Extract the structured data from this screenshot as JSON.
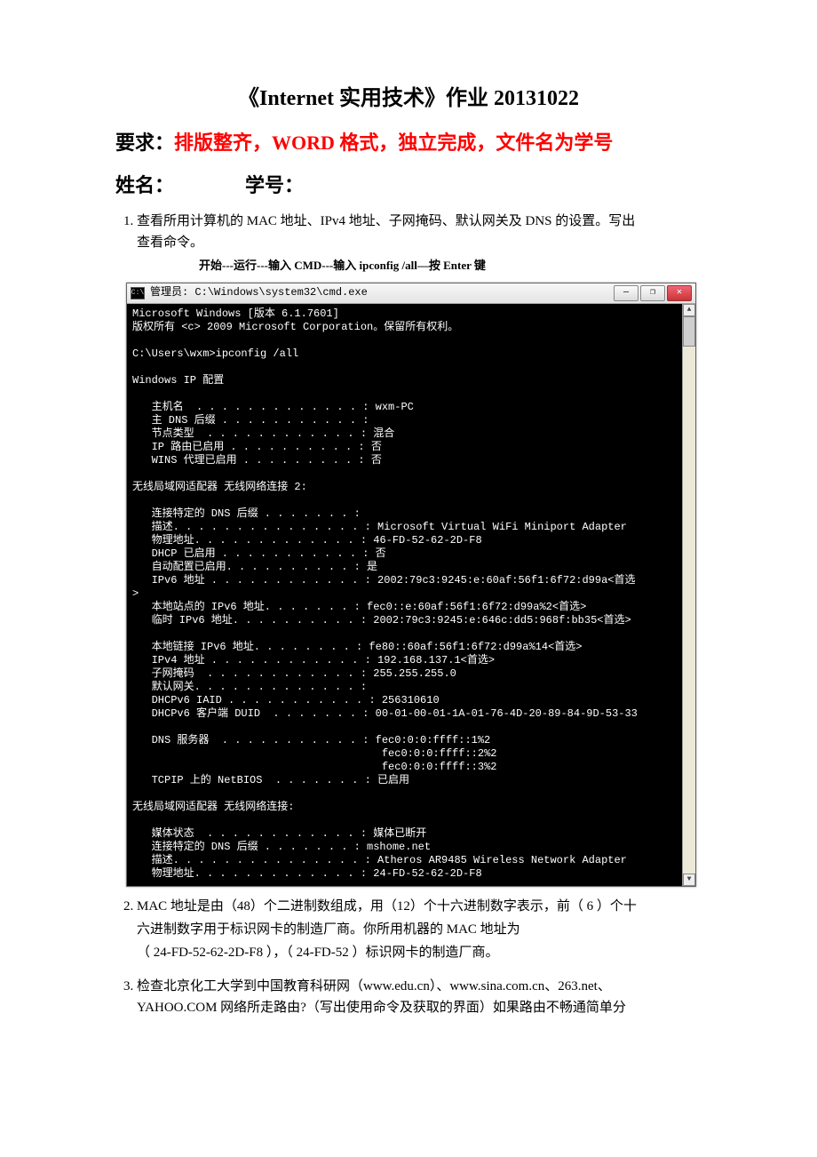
{
  "title": "《Internet 实用技术》作业 20131022",
  "requirement": {
    "prefix": "要求：",
    "red": "排版整齐，WORD 格式，独立完成，文件名为学号"
  },
  "name_line": {
    "name_label": "姓名：",
    "id_label": "学号："
  },
  "q1": {
    "text_line1": "查看所用计算机的 MAC 地址、IPv4 地址、子网掩码、默认网关及 DNS 的设置。写出",
    "text_line2": "查看命令。",
    "hint": "开始---运行---输入 CMD---输入 ipconfig /all—按 Enter 键"
  },
  "console": {
    "title": "管理员: C:\\Windows\\system32\\cmd.exe",
    "lines": [
      "Microsoft Windows [版本 6.1.7601]",
      "版权所有 <c> 2009 Microsoft Corporation。保留所有权利。",
      "",
      "C:\\Users\\wxm>ipconfig /all",
      "",
      "Windows IP 配置",
      "",
      "   主机名  . . . . . . . . . . . . . : wxm-PC",
      "   主 DNS 后缀 . . . . . . . . . . . :",
      "   节点类型  . . . . . . . . . . . . : 混合",
      "   IP 路由已启用 . . . . . . . . . . : 否",
      "   WINS 代理已启用 . . . . . . . . . : 否",
      "",
      "无线局域网适配器 无线网络连接 2:",
      "",
      "   连接特定的 DNS 后缀 . . . . . . . :",
      "   描述. . . . . . . . . . . . . . . : Microsoft Virtual WiFi Miniport Adapter",
      "   物理地址. . . . . . . . . . . . . : 46-FD-52-62-2D-F8",
      "   DHCP 已启用 . . . . . . . . . . . : 否",
      "   自动配置已启用. . . . . . . . . . : 是",
      "   IPv6 地址 . . . . . . . . . . . . : 2002:79c3:9245:e:60af:56f1:6f72:d99a<首选",
      ">",
      "   本地站点的 IPv6 地址. . . . . . . : fec0::e:60af:56f1:6f72:d99a%2<首选>",
      "   临时 IPv6 地址. . . . . . . . . . : 2002:79c3:9245:e:646c:dd5:968f:bb35<首选>",
      "",
      "   本地链接 IPv6 地址. . . . . . . . : fe80::60af:56f1:6f72:d99a%14<首选>",
      "   IPv4 地址 . . . . . . . . . . . . : 192.168.137.1<首选>",
      "   子网掩码  . . . . . . . . . . . . : 255.255.255.0",
      "   默认网关. . . . . . . . . . . . . :",
      "   DHCPv6 IAID . . . . . . . . . . . : 256310610",
      "   DHCPv6 客户端 DUID  . . . . . . . : 00-01-00-01-1A-01-76-4D-20-89-84-9D-53-33",
      "",
      "   DNS 服务器  . . . . . . . . . . . : fec0:0:0:ffff::1%2",
      "                                       fec0:0:0:ffff::2%2",
      "                                       fec0:0:0:ffff::3%2",
      "   TCPIP 上的 NetBIOS  . . . . . . . : 已启用",
      "",
      "无线局域网适配器 无线网络连接:",
      "",
      "   媒体状态  . . . . . . . . . . . . : 媒体已断开",
      "   连接特定的 DNS 后缀 . . . . . . . : mshome.net",
      "   描述. . . . . . . . . . . . . . . : Atheros AR9485 Wireless Network Adapter",
      "   物理地址. . . . . . . . . . . . . : 24-FD-52-62-2D-F8"
    ]
  },
  "q2": {
    "line1": "MAC 地址是由（48）个二进制数组成，用（12）个十六进制数字表示，前（ 6 ）个十",
    "line2": "六进制数字用于标识网卡的制造厂商。你所用机器的 MAC 地址为",
    "line3": "（  24-FD-52-62-2D-F8  ），（     24-FD-52     ）标识网卡的制造厂商。"
  },
  "q3": {
    "line1": "检查北京化工大学到中国教育科研网（www.edu.cn）、www.sina.com.cn、263.net、",
    "line2": "YAHOO.COM 网络所走路由?（写出使用命令及获取的界面）如果路由不畅通简单分"
  },
  "winbtn": {
    "min": "—",
    "max": "❐",
    "close": "✕",
    "cmd_glyph": "C:\\"
  }
}
